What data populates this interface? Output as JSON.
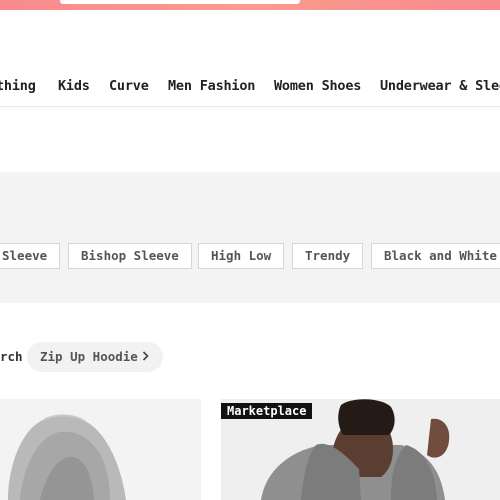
{
  "nav": {
    "items": [
      "thing",
      "Kids",
      "Curve",
      "Men Fashion",
      "Women Shoes",
      "Underwear & Slee"
    ]
  },
  "tags": [
    "Sleeve",
    "Bishop Sleeve",
    "High Low",
    "Trendy",
    "Black and White"
  ],
  "related": {
    "label": "rch",
    "chip": "Zip Up Hoodie",
    "chip_icon": "chevron-right-icon"
  },
  "products": [
    {
      "image": "gray-hoodie-product-image"
    },
    {
      "badge": "Marketplace",
      "image": "model-gray-hoodie-image"
    }
  ],
  "colors": {
    "accent_top_bar": "#f98a8d",
    "tag_band": "#f4f4f4",
    "badge_bg": "#111111"
  }
}
